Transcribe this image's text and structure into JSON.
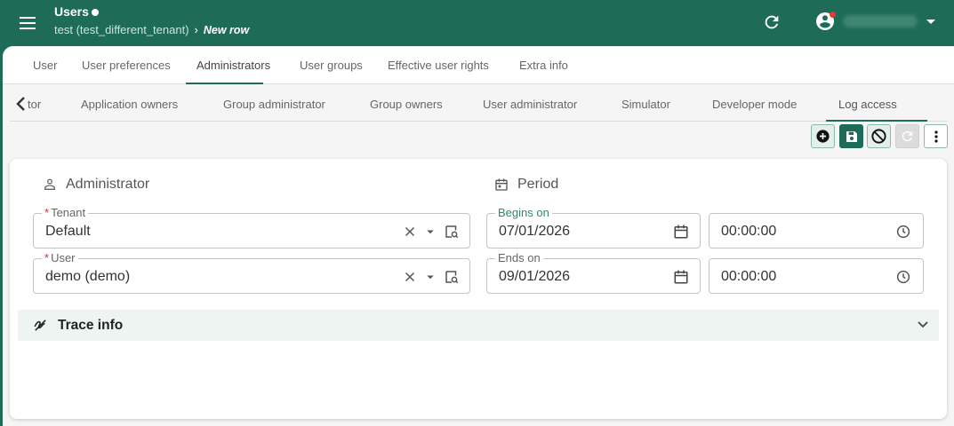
{
  "header": {
    "app_title": "Users",
    "breadcrumb_tenant": "test (test_different_tenant)",
    "breadcrumb_sep": "›",
    "breadcrumb_current": "New row"
  },
  "tabs_primary": [
    {
      "label": "User"
    },
    {
      "label": "User preferences"
    },
    {
      "label": "Administrators"
    },
    {
      "label": "User groups"
    },
    {
      "label": "Effective user rights"
    },
    {
      "label": "Extra info"
    }
  ],
  "tabs_secondary": [
    {
      "label": "tor"
    },
    {
      "label": "Application owners"
    },
    {
      "label": "Group administrator"
    },
    {
      "label": "Group owners"
    },
    {
      "label": "User administrator"
    },
    {
      "label": "Simulator"
    },
    {
      "label": "Developer mode"
    },
    {
      "label": "Log access"
    }
  ],
  "toolbar": {
    "icons": [
      "add-icon",
      "save-icon",
      "cancel-icon",
      "refresh-icon",
      "more-icon"
    ]
  },
  "form": {
    "administrator_title": "Administrator",
    "period_title": "Period",
    "tenant": {
      "label": "Tenant",
      "required_mark": "*",
      "value": "Default"
    },
    "user": {
      "label": "User",
      "required_mark": "*",
      "value": "demo (demo)"
    },
    "begins_on": {
      "label": "Begins on",
      "date": "07/01/2026",
      "time": "00:00:00"
    },
    "ends_on": {
      "label": "Ends on",
      "date": "09/01/2026",
      "time": "00:00:00"
    },
    "trace_info": "Trace info"
  },
  "colors": {
    "brand": "#1e6b57",
    "accent_label": "#2a8a6e",
    "required": "#d32f2f",
    "notification": "#e53935"
  }
}
